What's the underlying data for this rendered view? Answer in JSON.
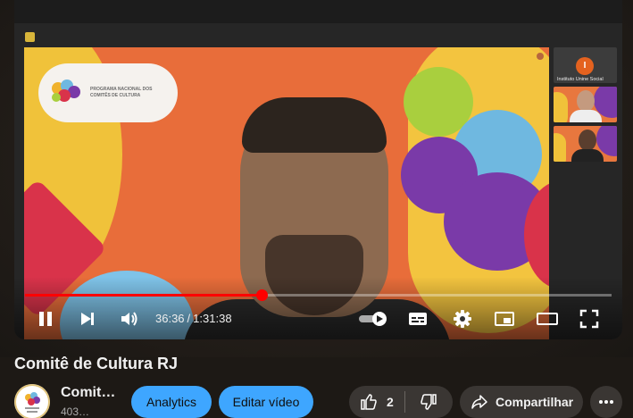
{
  "player": {
    "state": "playing",
    "current_time": "36:36",
    "time_separator": "/",
    "duration": "1:31:38",
    "progress_fraction": 0.403,
    "accent_color": "#ff0000",
    "autoplay": "on"
  },
  "meeting": {
    "logo_text": "PROGRAMA NACIONAL DOS COMITÊS DE CULTURA",
    "participants": [
      {
        "label": "Instituto Unine Social",
        "initial": "I"
      },
      {
        "label": ""
      },
      {
        "label": ""
      }
    ]
  },
  "video": {
    "title": "Comitê de Cultura RJ"
  },
  "channel": {
    "name": "Comit…",
    "subscribers": "403…"
  },
  "actions": {
    "analytics_label": "Analytics",
    "edit_label": "Editar vídeo",
    "like_count": "2",
    "share_label": "Compartilhar"
  },
  "icons": {
    "pause": "pause-icon",
    "next": "next-icon",
    "volume": "volume-icon",
    "autoplay": "autoplay-toggle-icon",
    "captions": "captions-icon",
    "settings": "gear-icon",
    "miniplayer": "miniplayer-icon",
    "theater": "theater-icon",
    "fullscreen": "fullscreen-icon",
    "like": "thumbs-up-icon",
    "dislike": "thumbs-down-icon",
    "share": "share-icon",
    "more": "more-icon"
  }
}
